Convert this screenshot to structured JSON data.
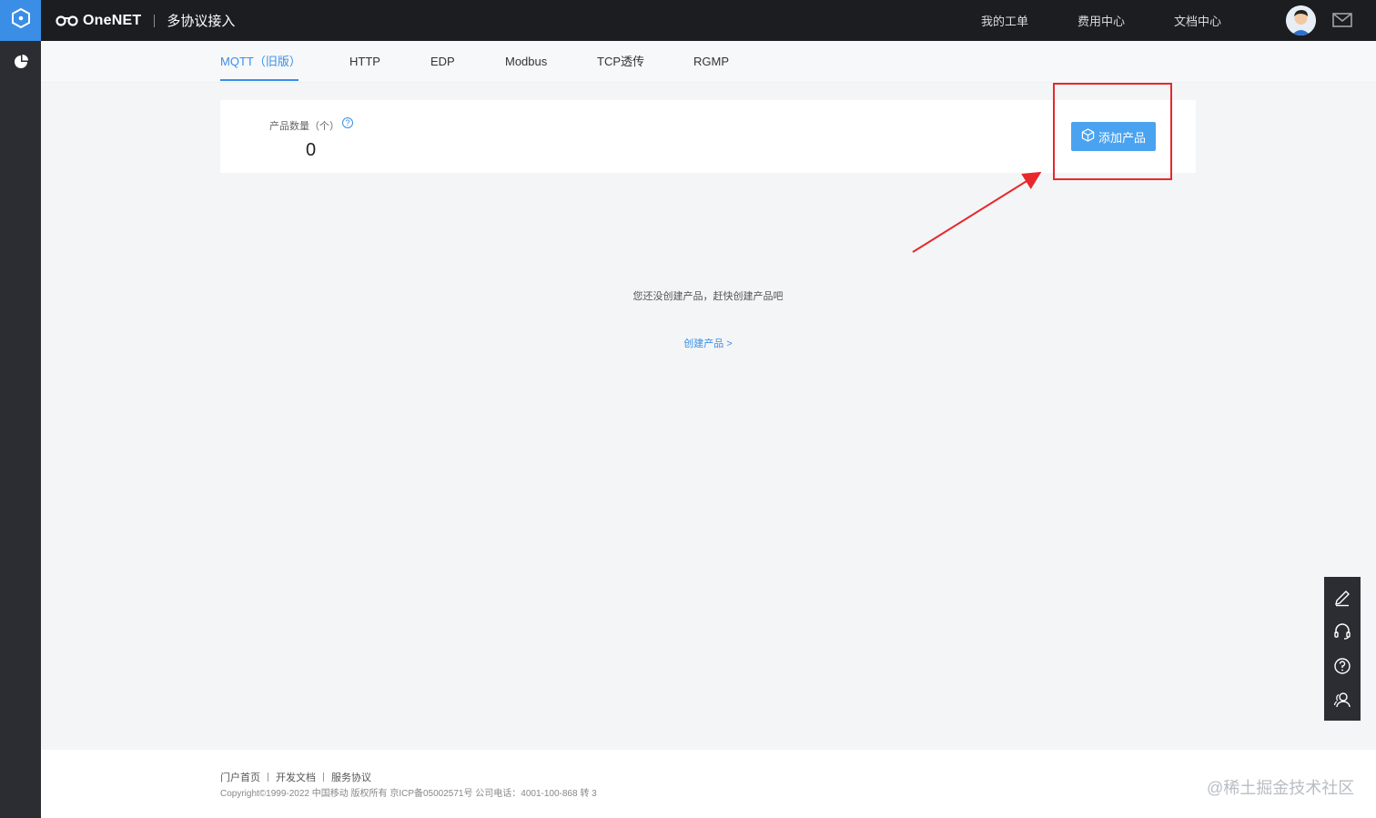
{
  "header": {
    "brand_name": "OneNET",
    "page_title": "多协议接入",
    "nav": [
      "我的工单",
      "费用中心",
      "文档中心"
    ]
  },
  "tabs": [
    "MQTT（旧版）",
    "HTTP",
    "EDP",
    "Modbus",
    "TCP透传",
    "RGMP"
  ],
  "active_tab": "MQTT（旧版）",
  "summary": {
    "label": "产品数量（个）",
    "help": "?",
    "count": "0"
  },
  "add_button": "添加产品",
  "empty": {
    "message": "您还没创建产品，赶快创建产品吧",
    "link": "创建产品 >"
  },
  "footer": {
    "links": [
      "门户首页",
      "开发文档",
      "服务协议"
    ],
    "copyright": "Copyright©1999-2022 中国移动 版权所有 京ICP备05002571号 公司电话：4001-100-868 转 3"
  },
  "watermark": "@稀土掘金技术社区",
  "colors": {
    "accent": "#3a8ee6",
    "button": "#4aa3f0",
    "annotation": "#e8282b",
    "topbar": "#1c1d21",
    "sidebar": "#2b2d33"
  },
  "icons": [
    "hexagon-logo-icon",
    "pie-chart-icon",
    "mail-icon",
    "cube-icon",
    "edit-icon",
    "headset-icon",
    "help-icon",
    "users-icon"
  ]
}
